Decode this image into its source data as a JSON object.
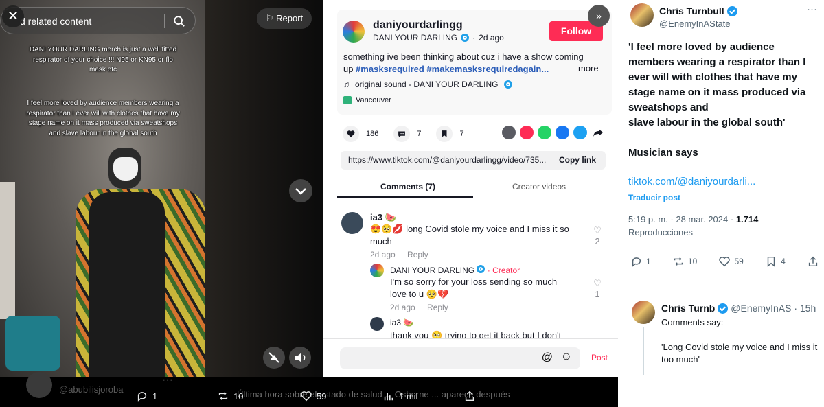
{
  "video": {
    "search_placeholder": "d related content",
    "report_label": "Report",
    "overlay_para1": "DANI YOUR DARLING merch is just a well fitted respirator of your choice !!! N95 or KN95 or flo mask etc",
    "overlay_para2": "I feel more loved by audience members wearing a respirator than i ever will with clothes that have my stage name on it mass produced via sweatshops and slave labour in the global south"
  },
  "underlay": {
    "handle": "@abubilisjoroba",
    "text": "Última hora sobre el estado de salud ... Osborne ... aparece después",
    "replies": "1",
    "reposts": "10",
    "likes": "59",
    "views": "1 mil"
  },
  "tiktok": {
    "username": "daniyourdarlingg",
    "nickname": "DANI YOUR DARLING",
    "posted": "2d ago",
    "follow_label": "Follow",
    "caption_text": "something ive been thinking about cuz i have a show coming up ",
    "tag1": "#masksrequired",
    "tag2": "#makemasksrequiredagain...",
    "more_label": "more",
    "sound": "original sound - DANI YOUR DARLING",
    "location": "Vancouver",
    "likes": "186",
    "comments_count": "7",
    "saves": "7",
    "link": "https://www.tiktok.com/@daniyourdarlingg/video/735...",
    "copy_label": "Copy link",
    "tab_comments": "Comments (7)",
    "tab_creator": "Creator videos",
    "post_label": "Post",
    "comments": [
      {
        "name": "ia3 🍉",
        "text": "😍🥺💋 long Covid stole my voice and I miss it so much",
        "time": "2d ago",
        "reply": "Reply",
        "likes": "2"
      },
      {
        "name": "DANI YOUR DARLING",
        "creator": "· Creator",
        "text": "I'm so sorry for your loss sending so much love to u 🥺💔",
        "time": "2d ago",
        "reply": "Reply",
        "likes": "1"
      },
      {
        "name": "ia3 🍉",
        "text": "thank you 🥺 trying to get it back but I don't"
      }
    ]
  },
  "tweet": {
    "name": "Chris Turnbull",
    "handle": "@EnemyInAState",
    "body1": "'I feel more loved by audience members wearing a respirator than I ever will with clothes that have my stage name on it mass produced via sweatshops and",
    "body2": "slave labour in the global south'",
    "body3": "Musician says",
    "link": "tiktok.com/@daniyourdarli...",
    "translate": "Traducir post",
    "time": "5:19 p. m. · 28 mar. 2024 · ",
    "views": "1.714",
    "views_label": "Reproducciones",
    "replies": "1",
    "reposts": "10",
    "likes": "59",
    "bookmarks": "4"
  },
  "reply": {
    "name": "Chris Turnb",
    "handle": "@EnemyInAS · 15h",
    "line1": "Comments say:",
    "line2": "'Long Covid stole my voice and I miss it too much'"
  }
}
